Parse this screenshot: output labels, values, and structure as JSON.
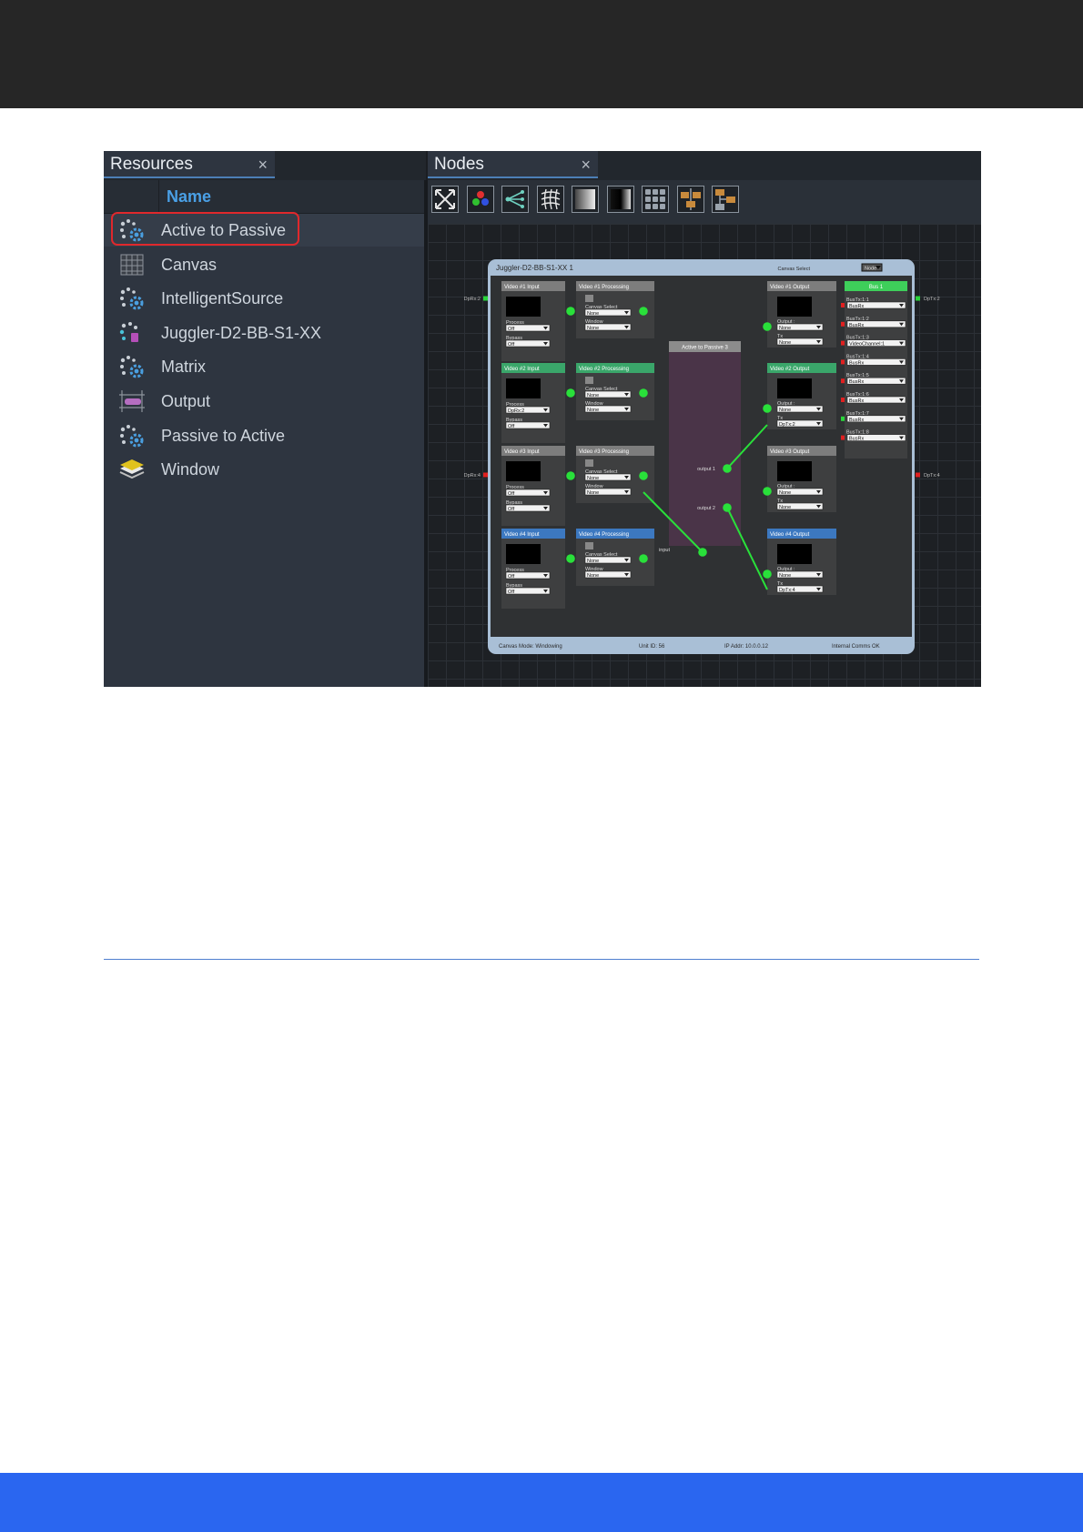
{
  "resources": {
    "tab_label": "Resources",
    "close_glyph": "×",
    "column_name": "Name",
    "items": [
      {
        "label": "Active to Passive",
        "icon": "gear-cluster-icon"
      },
      {
        "label": "Canvas",
        "icon": "canvas-grid-icon"
      },
      {
        "label": "IntelligentSource",
        "icon": "gear-cluster-icon"
      },
      {
        "label": "Juggler-D2-BB-S1-XX",
        "icon": "juggler-device-icon"
      },
      {
        "label": "Matrix",
        "icon": "gear-cluster-icon"
      },
      {
        "label": "Output",
        "icon": "output-icon"
      },
      {
        "label": "Passive to Active",
        "icon": "gear-cluster-icon"
      },
      {
        "label": "Window",
        "icon": "window-layers-icon"
      }
    ],
    "highlight_color": "#e0282c"
  },
  "nodes": {
    "tab_label": "Nodes",
    "close_glyph": "×",
    "toolbar_icons": [
      "fit-view-icon",
      "color-source-icon",
      "split-tree-icon",
      "warp-grid-icon",
      "gradient-icon",
      "dark-gradient-icon",
      "tile-grid-icon",
      "node-chain-icon",
      "node-branch-icon"
    ]
  },
  "graph": {
    "device_title": "Juggler-D2-BB-S1-XX 1",
    "canvas_select_label": "Canvas Select",
    "canvas_select_value": "Node",
    "left_ports": [
      "DpRx:2",
      "DpRx:4"
    ],
    "right_ports": [
      "DpTx:2",
      "DpTx:4"
    ],
    "inputs": [
      {
        "title": "Video #1 Input",
        "process": "Off",
        "bypass": "Off",
        "accent": "#7d7d7d"
      },
      {
        "title": "Video #2 Input",
        "process": "DpRx:2",
        "bypass": "Off",
        "accent": "#3aa66a"
      },
      {
        "title": "Video #3 Input",
        "process": "Off",
        "bypass": "Off",
        "accent": "#7d7d7d"
      },
      {
        "title": "Video #4 Input",
        "process": "Off",
        "bypass": "Off",
        "accent": "#3c78c0"
      }
    ],
    "processing": [
      {
        "title": "Video #1 Processing",
        "canvas": "None",
        "window": "None",
        "accent": "#7d7d7d"
      },
      {
        "title": "Video #2 Processing",
        "canvas": "None",
        "window": "None",
        "accent": "#3aa66a"
      },
      {
        "title": "Video #3 Processing",
        "canvas": "None",
        "window": "None",
        "accent": "#7d7d7d"
      },
      {
        "title": "Video #4 Processing",
        "canvas": "None",
        "window": "None",
        "accent": "#3c78c0"
      }
    ],
    "outputs": [
      {
        "title": "Video #1 Output",
        "output": "None",
        "tx": "None",
        "accent": "#7d7d7d"
      },
      {
        "title": "Video #2 Output",
        "output": "None",
        "tx": "DpTx:2",
        "accent": "#3aa66a"
      },
      {
        "title": "Video #3 Output",
        "output": "None",
        "tx": "None",
        "accent": "#7d7d7d"
      },
      {
        "title": "Video #4 Output",
        "output": "None",
        "tx": "DpTx:4",
        "accent": "#3c78c0"
      }
    ],
    "labels": {
      "process": "Process",
      "bypass": "Bypass",
      "canvas_select": "Canvas Select",
      "window": "Window",
      "output": "Output :",
      "tx": "Tx"
    },
    "active_passive": {
      "title": "Active to Passive 3",
      "output1": "output 1",
      "output2": "output 2",
      "input": "input"
    },
    "bus": {
      "title": "Bus 1",
      "rows": [
        {
          "label": "BusTx:1:1",
          "value": "BusRx"
        },
        {
          "label": "BusTx:1:2",
          "value": "BusRx"
        },
        {
          "label": "BusTx:1:3",
          "value": "VideoChannel:1"
        },
        {
          "label": "BusTx:1:4",
          "value": "BusRx"
        },
        {
          "label": "BusTx:1:5",
          "value": "BusRx"
        },
        {
          "label": "BusTx:1:6",
          "value": "BusRx"
        },
        {
          "label": "BusTx:1:7",
          "value": "BusRx"
        },
        {
          "label": "BusTx:1:8",
          "value": "BusRx"
        }
      ]
    },
    "footer": {
      "mode": "Canvas Mode: Windowing",
      "unit": "Unit ID: 56",
      "ip": "IP Addr: 10.0.0.12",
      "comms": "Internal Comms OK"
    },
    "colors": {
      "link": "#29e03a",
      "port_red": "#e02020",
      "port_green": "#29d43a",
      "device_bg": "#2f3133",
      "device_frame": "#a9bfd6",
      "module_bg": "#3e3f40",
      "ap_bg": "#4a3448"
    }
  }
}
